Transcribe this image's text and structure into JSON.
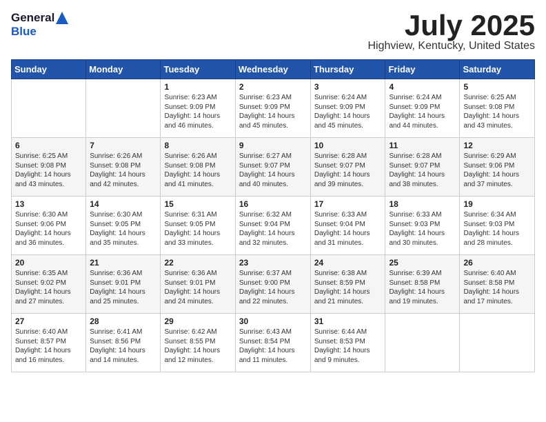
{
  "header": {
    "logo_general": "General",
    "logo_blue": "Blue",
    "month_title": "July 2025",
    "location": "Highview, Kentucky, United States"
  },
  "weekdays": [
    "Sunday",
    "Monday",
    "Tuesday",
    "Wednesday",
    "Thursday",
    "Friday",
    "Saturday"
  ],
  "weeks": [
    [
      {
        "day": "",
        "sunrise": "",
        "sunset": "",
        "daylight": ""
      },
      {
        "day": "",
        "sunrise": "",
        "sunset": "",
        "daylight": ""
      },
      {
        "day": "1",
        "sunrise": "Sunrise: 6:23 AM",
        "sunset": "Sunset: 9:09 PM",
        "daylight": "Daylight: 14 hours and 46 minutes."
      },
      {
        "day": "2",
        "sunrise": "Sunrise: 6:23 AM",
        "sunset": "Sunset: 9:09 PM",
        "daylight": "Daylight: 14 hours and 45 minutes."
      },
      {
        "day": "3",
        "sunrise": "Sunrise: 6:24 AM",
        "sunset": "Sunset: 9:09 PM",
        "daylight": "Daylight: 14 hours and 45 minutes."
      },
      {
        "day": "4",
        "sunrise": "Sunrise: 6:24 AM",
        "sunset": "Sunset: 9:09 PM",
        "daylight": "Daylight: 14 hours and 44 minutes."
      },
      {
        "day": "5",
        "sunrise": "Sunrise: 6:25 AM",
        "sunset": "Sunset: 9:08 PM",
        "daylight": "Daylight: 14 hours and 43 minutes."
      }
    ],
    [
      {
        "day": "6",
        "sunrise": "Sunrise: 6:25 AM",
        "sunset": "Sunset: 9:08 PM",
        "daylight": "Daylight: 14 hours and 43 minutes."
      },
      {
        "day": "7",
        "sunrise": "Sunrise: 6:26 AM",
        "sunset": "Sunset: 9:08 PM",
        "daylight": "Daylight: 14 hours and 42 minutes."
      },
      {
        "day": "8",
        "sunrise": "Sunrise: 6:26 AM",
        "sunset": "Sunset: 9:08 PM",
        "daylight": "Daylight: 14 hours and 41 minutes."
      },
      {
        "day": "9",
        "sunrise": "Sunrise: 6:27 AM",
        "sunset": "Sunset: 9:07 PM",
        "daylight": "Daylight: 14 hours and 40 minutes."
      },
      {
        "day": "10",
        "sunrise": "Sunrise: 6:28 AM",
        "sunset": "Sunset: 9:07 PM",
        "daylight": "Daylight: 14 hours and 39 minutes."
      },
      {
        "day": "11",
        "sunrise": "Sunrise: 6:28 AM",
        "sunset": "Sunset: 9:07 PM",
        "daylight": "Daylight: 14 hours and 38 minutes."
      },
      {
        "day": "12",
        "sunrise": "Sunrise: 6:29 AM",
        "sunset": "Sunset: 9:06 PM",
        "daylight": "Daylight: 14 hours and 37 minutes."
      }
    ],
    [
      {
        "day": "13",
        "sunrise": "Sunrise: 6:30 AM",
        "sunset": "Sunset: 9:06 PM",
        "daylight": "Daylight: 14 hours and 36 minutes."
      },
      {
        "day": "14",
        "sunrise": "Sunrise: 6:30 AM",
        "sunset": "Sunset: 9:05 PM",
        "daylight": "Daylight: 14 hours and 35 minutes."
      },
      {
        "day": "15",
        "sunrise": "Sunrise: 6:31 AM",
        "sunset": "Sunset: 9:05 PM",
        "daylight": "Daylight: 14 hours and 33 minutes."
      },
      {
        "day": "16",
        "sunrise": "Sunrise: 6:32 AM",
        "sunset": "Sunset: 9:04 PM",
        "daylight": "Daylight: 14 hours and 32 minutes."
      },
      {
        "day": "17",
        "sunrise": "Sunrise: 6:33 AM",
        "sunset": "Sunset: 9:04 PM",
        "daylight": "Daylight: 14 hours and 31 minutes."
      },
      {
        "day": "18",
        "sunrise": "Sunrise: 6:33 AM",
        "sunset": "Sunset: 9:03 PM",
        "daylight": "Daylight: 14 hours and 30 minutes."
      },
      {
        "day": "19",
        "sunrise": "Sunrise: 6:34 AM",
        "sunset": "Sunset: 9:03 PM",
        "daylight": "Daylight: 14 hours and 28 minutes."
      }
    ],
    [
      {
        "day": "20",
        "sunrise": "Sunrise: 6:35 AM",
        "sunset": "Sunset: 9:02 PM",
        "daylight": "Daylight: 14 hours and 27 minutes."
      },
      {
        "day": "21",
        "sunrise": "Sunrise: 6:36 AM",
        "sunset": "Sunset: 9:01 PM",
        "daylight": "Daylight: 14 hours and 25 minutes."
      },
      {
        "day": "22",
        "sunrise": "Sunrise: 6:36 AM",
        "sunset": "Sunset: 9:01 PM",
        "daylight": "Daylight: 14 hours and 24 minutes."
      },
      {
        "day": "23",
        "sunrise": "Sunrise: 6:37 AM",
        "sunset": "Sunset: 9:00 PM",
        "daylight": "Daylight: 14 hours and 22 minutes."
      },
      {
        "day": "24",
        "sunrise": "Sunrise: 6:38 AM",
        "sunset": "Sunset: 8:59 PM",
        "daylight": "Daylight: 14 hours and 21 minutes."
      },
      {
        "day": "25",
        "sunrise": "Sunrise: 6:39 AM",
        "sunset": "Sunset: 8:58 PM",
        "daylight": "Daylight: 14 hours and 19 minutes."
      },
      {
        "day": "26",
        "sunrise": "Sunrise: 6:40 AM",
        "sunset": "Sunset: 8:58 PM",
        "daylight": "Daylight: 14 hours and 17 minutes."
      }
    ],
    [
      {
        "day": "27",
        "sunrise": "Sunrise: 6:40 AM",
        "sunset": "Sunset: 8:57 PM",
        "daylight": "Daylight: 14 hours and 16 minutes."
      },
      {
        "day": "28",
        "sunrise": "Sunrise: 6:41 AM",
        "sunset": "Sunset: 8:56 PM",
        "daylight": "Daylight: 14 hours and 14 minutes."
      },
      {
        "day": "29",
        "sunrise": "Sunrise: 6:42 AM",
        "sunset": "Sunset: 8:55 PM",
        "daylight": "Daylight: 14 hours and 12 minutes."
      },
      {
        "day": "30",
        "sunrise": "Sunrise: 6:43 AM",
        "sunset": "Sunset: 8:54 PM",
        "daylight": "Daylight: 14 hours and 11 minutes."
      },
      {
        "day": "31",
        "sunrise": "Sunrise: 6:44 AM",
        "sunset": "Sunset: 8:53 PM",
        "daylight": "Daylight: 14 hours and 9 minutes."
      },
      {
        "day": "",
        "sunrise": "",
        "sunset": "",
        "daylight": ""
      },
      {
        "day": "",
        "sunrise": "",
        "sunset": "",
        "daylight": ""
      }
    ]
  ]
}
